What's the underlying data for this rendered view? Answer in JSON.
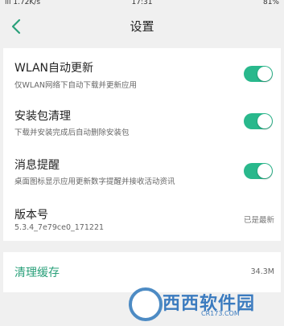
{
  "status_bar": {
    "left": "ill 1.72K/s",
    "time": "17:31",
    "right": "81%"
  },
  "nav": {
    "title": "设置"
  },
  "settings": [
    {
      "label": "WLAN自动更新",
      "desc": "仅WLAN网络下自动下载并更新应用",
      "toggle": "on"
    },
    {
      "label": "安装包清理",
      "desc": "下载并安装完成后自动删除安装包",
      "toggle": "on"
    },
    {
      "label": "消息提醒",
      "desc": "桌面图标显示应用更新数字提醒并接收活动资讯",
      "toggle": "on"
    }
  ],
  "version": {
    "label": "版本号",
    "value": "5.3.4_7e79ce0_171221",
    "status": "已是最新"
  },
  "cache": {
    "label": "清理缓存",
    "size": "34.3M"
  },
  "watermark": {
    "text": "西西软件园",
    "url": "CR173.COM"
  },
  "colors": {
    "accent": "#29b88c",
    "accent_text": "#2aa07a",
    "background": "#f0f0f0"
  }
}
